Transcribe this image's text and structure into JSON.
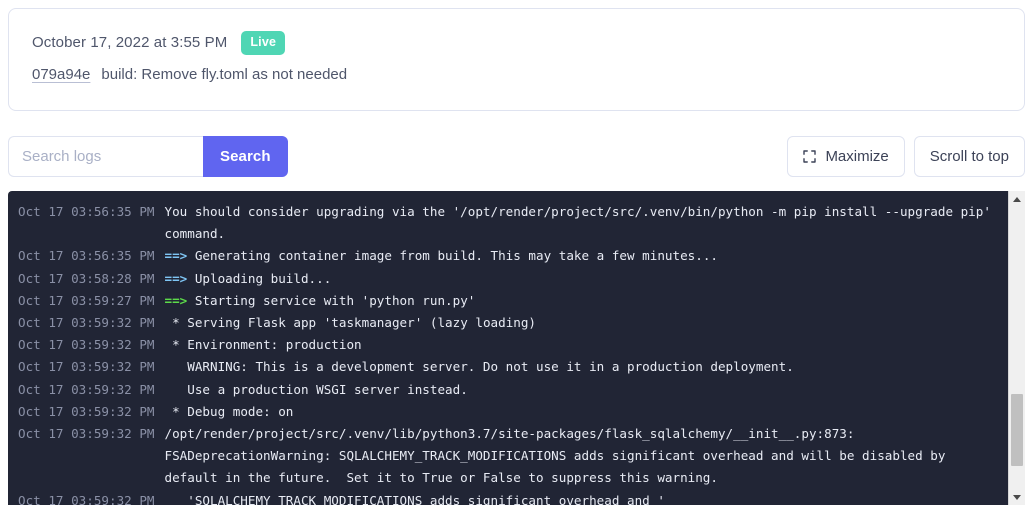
{
  "deploy": {
    "date": "October 17, 2022 at 3:55 PM",
    "status_badge": "Live",
    "commit_hash": "079a94e",
    "commit_message": "build: Remove fly.toml as not needed"
  },
  "toolbar": {
    "search_value": "",
    "search_placeholder": "Search logs",
    "search_button": "Search",
    "maximize_button": "Maximize",
    "maximize_icon": "maximize-corners-icon",
    "scroll_top_button": "Scroll to top"
  },
  "colors": {
    "accent_purple": "#6065f0",
    "live_green": "#4fd6b4",
    "console_bg": "#212535",
    "timestamp_gray": "#8a90a6",
    "log_text": "#e8ebf4",
    "arrow_cyan": "#7fc6f5",
    "arrow_green": "#5ddb4a"
  },
  "log": {
    "lines": [
      {
        "timestamp": "Oct 17 03:56:35 PM",
        "arrow": "",
        "arrow_color": "",
        "message": "You should consider upgrading via the '/opt/render/project/src/.venv/bin/python -m pip install --upgrade pip' command."
      },
      {
        "timestamp": "Oct 17 03:56:35 PM",
        "arrow": "==>",
        "arrow_color": "cyan",
        "message": " Generating container image from build. This may take a few minutes..."
      },
      {
        "timestamp": "Oct 17 03:58:28 PM",
        "arrow": "==>",
        "arrow_color": "cyan",
        "message": " Uploading build..."
      },
      {
        "timestamp": "Oct 17 03:59:27 PM",
        "arrow": "==>",
        "arrow_color": "green",
        "message": " Starting service with 'python run.py'"
      },
      {
        "timestamp": "Oct 17 03:59:32 PM",
        "arrow": "",
        "arrow_color": "",
        "message": " * Serving Flask app 'taskmanager' (lazy loading)"
      },
      {
        "timestamp": "Oct 17 03:59:32 PM",
        "arrow": "",
        "arrow_color": "",
        "message": " * Environment: production"
      },
      {
        "timestamp": "Oct 17 03:59:32 PM",
        "arrow": "",
        "arrow_color": "",
        "message": "   WARNING: This is a development server. Do not use it in a production deployment."
      },
      {
        "timestamp": "Oct 17 03:59:32 PM",
        "arrow": "",
        "arrow_color": "",
        "message": "   Use a production WSGI server instead."
      },
      {
        "timestamp": "Oct 17 03:59:32 PM",
        "arrow": "",
        "arrow_color": "",
        "message": " * Debug mode: on"
      },
      {
        "timestamp": "Oct 17 03:59:32 PM",
        "arrow": "",
        "arrow_color": "",
        "message": "/opt/render/project/src/.venv/lib/python3.7/site-packages/flask_sqlalchemy/__init__.py:873: FSADeprecationWarning: SQLALCHEMY_TRACK_MODIFICATIONS adds significant overhead and will be disabled by default in the future.  Set it to True or False to suppress this warning."
      },
      {
        "timestamp": "Oct 17 03:59:32 PM",
        "arrow": "",
        "arrow_color": "",
        "message": "   'SQLALCHEMY_TRACK_MODIFICATIONS adds significant overhead and '"
      }
    ]
  },
  "scrollbar": {
    "up_arrow_icon": "triangle-up-icon",
    "down_arrow_icon": "triangle-down-icon",
    "thumb": "scrollbar-thumb"
  }
}
